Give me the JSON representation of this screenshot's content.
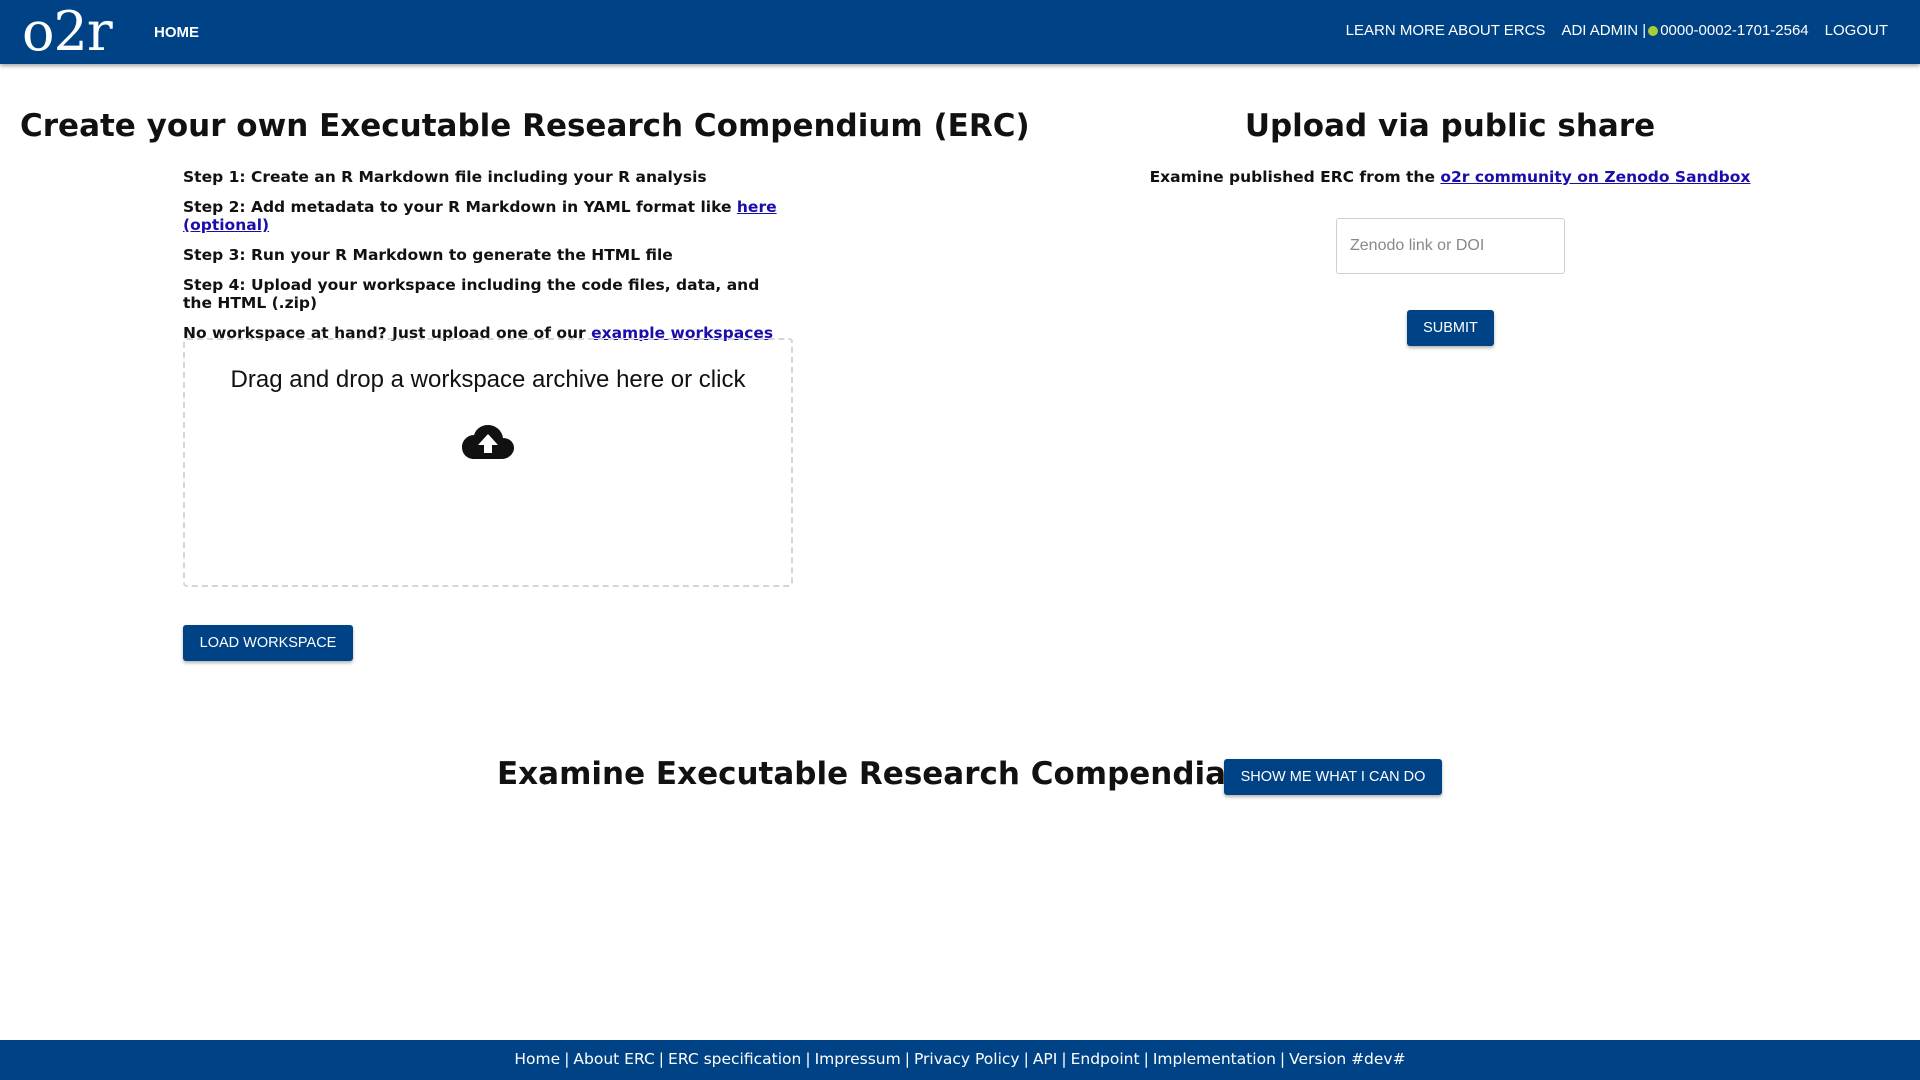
{
  "header": {
    "logo": "o2r",
    "home_label": "HOME",
    "learn_more_label": "LEARN MORE ABOUT ERCS",
    "user_name": "ADI ADMIN |",
    "orcid": "0000-0002-1701-2564",
    "logout_label": "LOGOUT",
    "brand_color": "#004286",
    "orcid_color": "#a6ce39"
  },
  "create": {
    "title": "Create your own Executable Research Compendium (ERC)",
    "step1": "Step 1: Create an R Markdown file including your R analysis",
    "step2_text": "Step 2: Add metadata to your R Markdown in YAML format like ",
    "step2_link": "here (optional)",
    "step3": "Step 3: Run your R Markdown to generate the HTML file",
    "step4": "Step 4: Upload your workspace including the code files, data, and the HTML (.zip)",
    "example_text": "No workspace at hand? Just upload one of our ",
    "example_link": "example workspaces",
    "dropzone_text": "Drag and drop a workspace archive here or click",
    "dropzone_icon": "cloud-upload-icon",
    "load_button": "LOAD WORKSPACE"
  },
  "share": {
    "title": "Upload via public share",
    "subtitle_text": "Examine published ERC from the ",
    "subtitle_link": "o2r community on Zenodo Sandbox",
    "input_placeholder": "Zenodo link or DOI",
    "input_value": "",
    "submit_button": "SUBMIT"
  },
  "examine": {
    "title": "Examine Executable Research Compendia",
    "show_button": "SHOW ME WHAT I CAN DO"
  },
  "footer": {
    "links": [
      "Home",
      "About ERC",
      "ERC specification",
      "Impressum",
      "Privacy Policy",
      "API",
      "Endpoint",
      "Implementation"
    ],
    "version": "Version #dev#"
  }
}
